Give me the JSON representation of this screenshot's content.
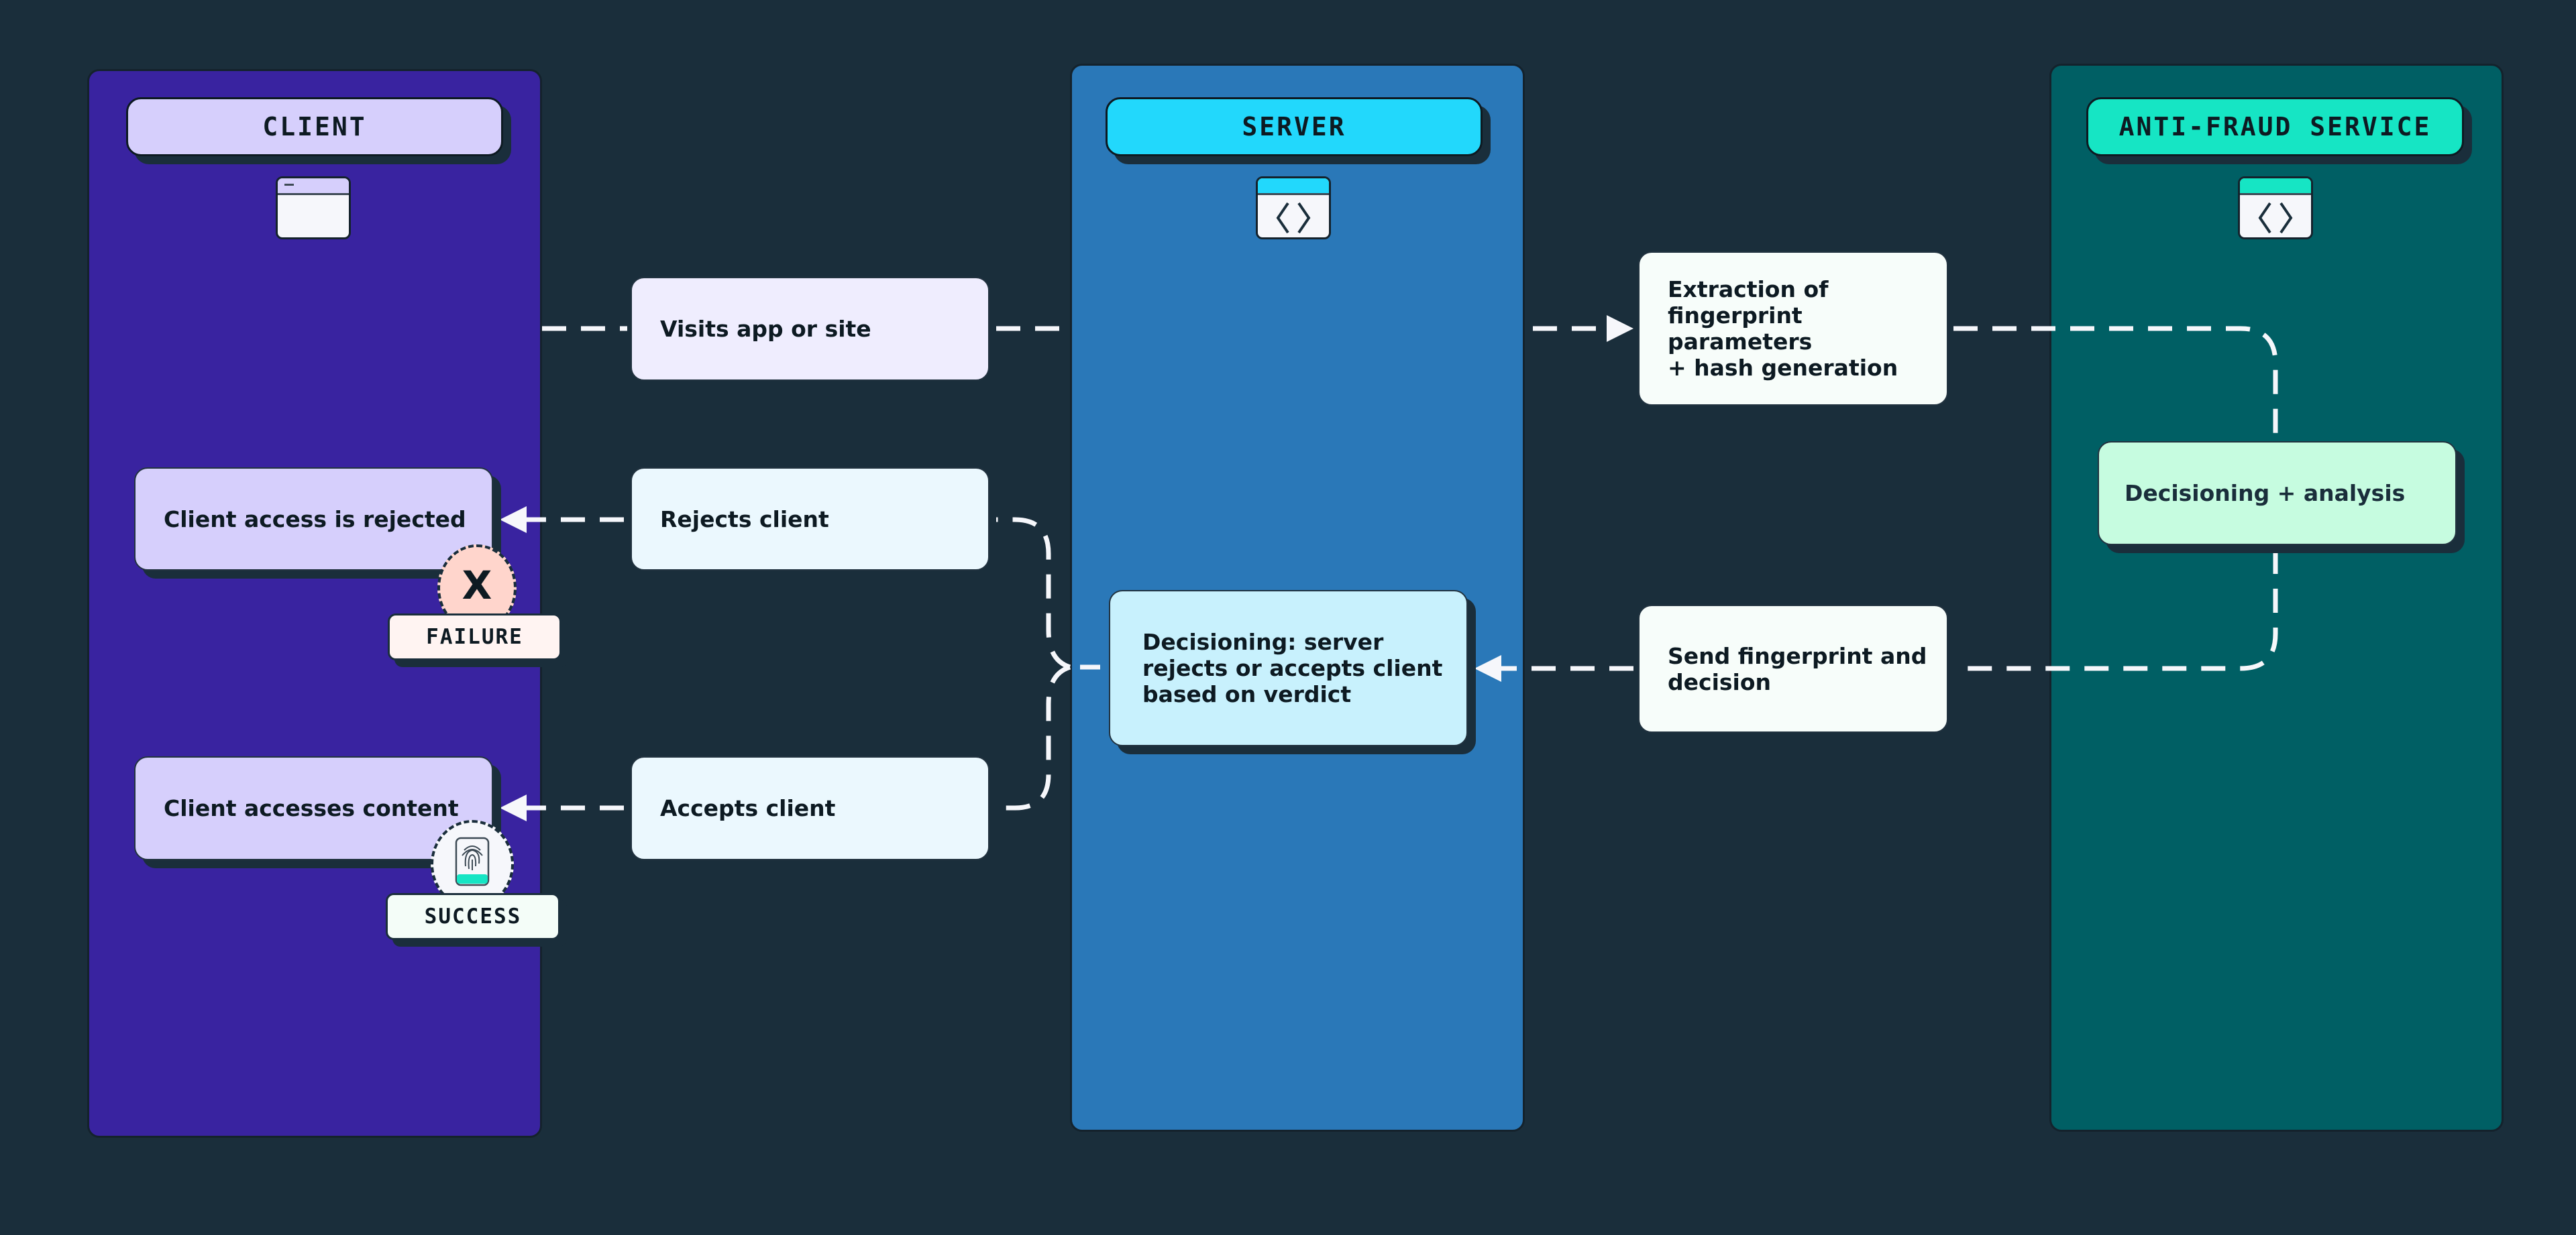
{
  "colors": {
    "background": "#1a2e3b",
    "client_panel": "#3923a0",
    "client_pill": "#d6cffc",
    "server_panel": "#2a78b8",
    "server_pill": "#22d8fc",
    "antifraud_panel": "#005f64",
    "antifraud_pill": "#16e5c4",
    "connector": "#f6f7fb"
  },
  "lanes": {
    "client": {
      "title": "CLIENT",
      "icon": "browser-window-icon"
    },
    "server": {
      "title": "SERVER",
      "icon": "code-window-icon"
    },
    "antifraud": {
      "title": "ANTI-FRAUD SERVICE",
      "icon": "code-window-icon"
    }
  },
  "steps": {
    "visits": "Visits app or site",
    "extraction": "Extraction of\nfingerprint parameters\n+ hash generation",
    "decisioning_analysis": "Decisioning + analysis",
    "send_fingerprint": "Send fingerprint and\ndecision",
    "server_decisioning": "Decisioning: server\nrejects or accepts client\nbased on verdict",
    "rejects_client": "Rejects client",
    "accepts_client": "Accepts client",
    "client_rejected": "Client access is rejected",
    "client_accesses": "Client accesses content"
  },
  "outcomes": {
    "failure": {
      "label": "FAILURE",
      "icon_text": "X"
    },
    "success": {
      "label": "SUCCESS",
      "icon": "fingerprint-icon"
    }
  }
}
